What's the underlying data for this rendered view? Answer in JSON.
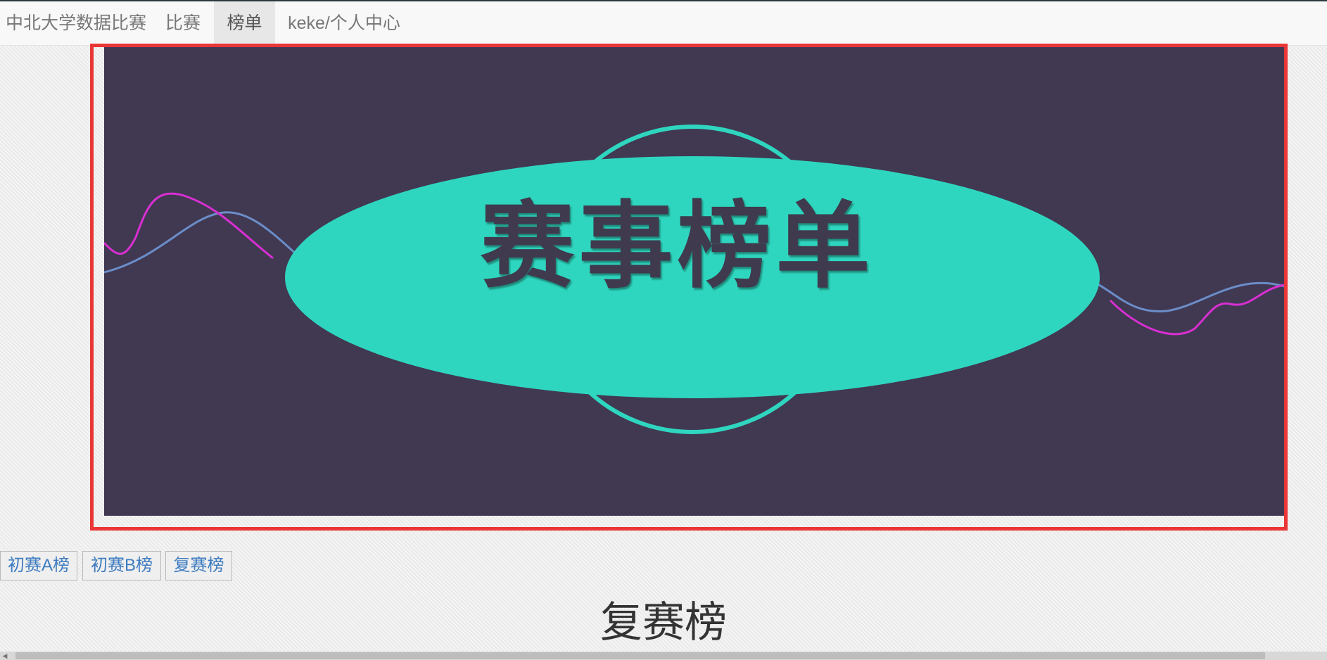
{
  "navbar": {
    "brand": "中北大学数据比赛",
    "items": [
      "比赛",
      "榜单",
      "keke/个人中心"
    ],
    "active_item": "榜单"
  },
  "banner": {
    "title": "赛事榜单",
    "colors": {
      "background": "#413852",
      "ellipse": "#2fd6bf",
      "frame": "#ea3636",
      "wave_pink": "#d82fd2",
      "wave_blue": "#6b8dc8"
    }
  },
  "tabs": [
    "初赛A榜",
    "初赛B榜",
    "复赛榜"
  ],
  "section_title": "复赛榜"
}
